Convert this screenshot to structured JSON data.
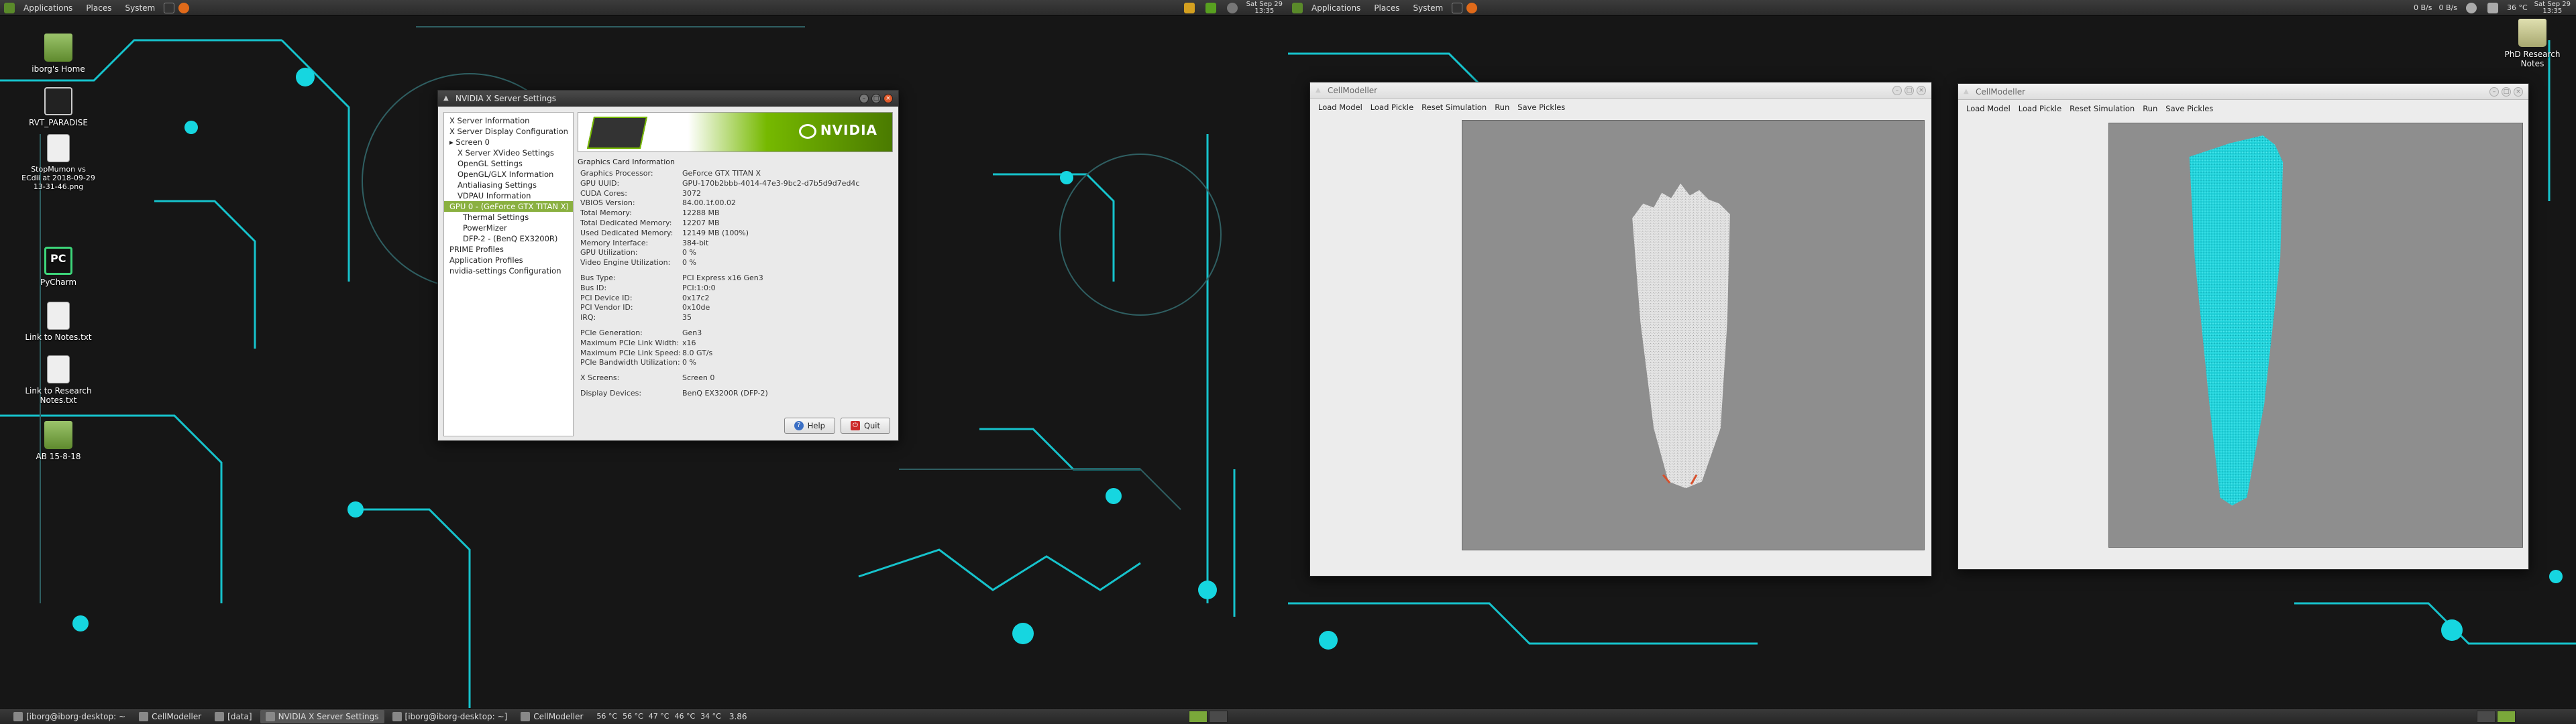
{
  "left_panel": {
    "menus": [
      "Applications",
      "Places",
      "System"
    ],
    "tray": {
      "clock_line1": "Sat Sep 29",
      "clock_line2": "13:35"
    }
  },
  "right_panel": {
    "menus": [
      "Applications",
      "Places",
      "System"
    ],
    "tray": {
      "net": "0 B/s",
      "net2": "0 B/s",
      "temp": "36 °C",
      "clock_line1": "Sat Sep 29",
      "clock_line2": "13:35"
    }
  },
  "desktop_icons": [
    {
      "label": "iborg's Home",
      "kind": "folder"
    },
    {
      "label": "RVT_PARADISE",
      "kind": "sound"
    },
    {
      "label": "StopMumon vs ECdii at 2018-09-29 13-31-46.png",
      "kind": "file"
    },
    {
      "label": "PyCharm",
      "kind": "pycharm"
    },
    {
      "label": "Link to Notes.txt",
      "kind": "file"
    },
    {
      "label": "Link to Research Notes.txt",
      "kind": "file"
    },
    {
      "label": "AB 15-8-18",
      "kind": "folder"
    }
  ],
  "right_desktop_icons": [
    {
      "label": "PhD Research Notes",
      "kind": "folder"
    }
  ],
  "nvidia": {
    "title": "NVIDIA X Server Settings",
    "tree": [
      {
        "label": "X Server Information",
        "level": 0
      },
      {
        "label": "X Server Display Configuration",
        "level": 0
      },
      {
        "label": "▸ Screen 0",
        "level": 0
      },
      {
        "label": "X Server XVideo Settings",
        "level": 1
      },
      {
        "label": "OpenGL Settings",
        "level": 1
      },
      {
        "label": "OpenGL/GLX Information",
        "level": 1
      },
      {
        "label": "Antialiasing Settings",
        "level": 1
      },
      {
        "label": "VDPAU Information",
        "level": 1
      },
      {
        "label": "GPU 0 - (GeForce GTX TITAN X)",
        "level": 0,
        "selected": true
      },
      {
        "label": "Thermal Settings",
        "level": 2
      },
      {
        "label": "PowerMizer",
        "level": 2
      },
      {
        "label": "DFP-2 - (BenQ EX3200R)",
        "level": 2
      },
      {
        "label": "PRIME Profiles",
        "level": 0
      },
      {
        "label": "Application Profiles",
        "level": 0
      },
      {
        "label": "nvidia-settings Configuration",
        "level": 0
      }
    ],
    "section_title": "Graphics Card Information",
    "group1": [
      {
        "k": "Graphics Processor:",
        "v": "GeForce GTX TITAN X"
      },
      {
        "k": "GPU UUID:",
        "v": "GPU-170b2bbb-4014-47e3-9bc2-d7b5d9d7ed4c"
      },
      {
        "k": "CUDA Cores:",
        "v": "3072"
      },
      {
        "k": "VBIOS Version:",
        "v": "84.00.1f.00.02"
      },
      {
        "k": "Total Memory:",
        "v": "12288 MB"
      },
      {
        "k": "Total Dedicated Memory:",
        "v": "12207 MB"
      },
      {
        "k": "Used Dedicated Memory:",
        "v": "12149 MB (100%)"
      },
      {
        "k": "Memory Interface:",
        "v": "384-bit"
      },
      {
        "k": "GPU Utilization:",
        "v": "0 %"
      },
      {
        "k": "Video Engine Utilization:",
        "v": "0 %"
      }
    ],
    "group2": [
      {
        "k": "Bus Type:",
        "v": "PCI Express x16 Gen3"
      },
      {
        "k": "Bus ID:",
        "v": "PCI:1:0:0"
      },
      {
        "k": "PCI Device ID:",
        "v": "0x17c2"
      },
      {
        "k": "PCI Vendor ID:",
        "v": "0x10de"
      },
      {
        "k": "IRQ:",
        "v": "35"
      }
    ],
    "group3": [
      {
        "k": "PCIe Generation:",
        "v": "Gen3"
      },
      {
        "k": "Maximum PCIe Link Width:",
        "v": "x16"
      },
      {
        "k": "Maximum PCIe Link Speed:",
        "v": "8.0 GT/s"
      },
      {
        "k": "PCIe Bandwidth Utilization:",
        "v": "0 %"
      }
    ],
    "group4": [
      {
        "k": "X Screens:",
        "v": "Screen 0"
      }
    ],
    "group5": [
      {
        "k": "Display Devices:",
        "v": "BenQ EX3200R (DFP-2)"
      }
    ],
    "help_label": "Help",
    "quit_label": "Quit",
    "logo_text": "NVIDIA"
  },
  "cellmodeller_left": {
    "title": "CellModeller",
    "menu": [
      "Load Model",
      "Load Pickle",
      "Reset Simulation",
      "Run",
      "Save Pickles"
    ],
    "colony_color": "#e4e4e4"
  },
  "cellmodeller_right": {
    "title": "CellModeller",
    "menu": [
      "Load Model",
      "Load Pickle",
      "Reset Simulation",
      "Run",
      "Save Pickles"
    ],
    "colony_color": "#22d4dc"
  },
  "left_taskbar": {
    "tasks": [
      {
        "label": "[iborg@iborg-desktop: ~",
        "active": false
      },
      {
        "label": "CellModeller",
        "active": false
      },
      {
        "label": "[data]",
        "active": false
      },
      {
        "label": "NVIDIA X Server Settings",
        "active": true
      },
      {
        "label": "[iborg@iborg-desktop: ~]",
        "active": false
      },
      {
        "label": "CellModeller",
        "active": false
      }
    ],
    "temps": [
      "56 °C",
      "56 °C",
      "47 °C",
      "46 °C",
      "34 °C"
    ],
    "load": "3.86"
  },
  "accent": "#16d6e0"
}
